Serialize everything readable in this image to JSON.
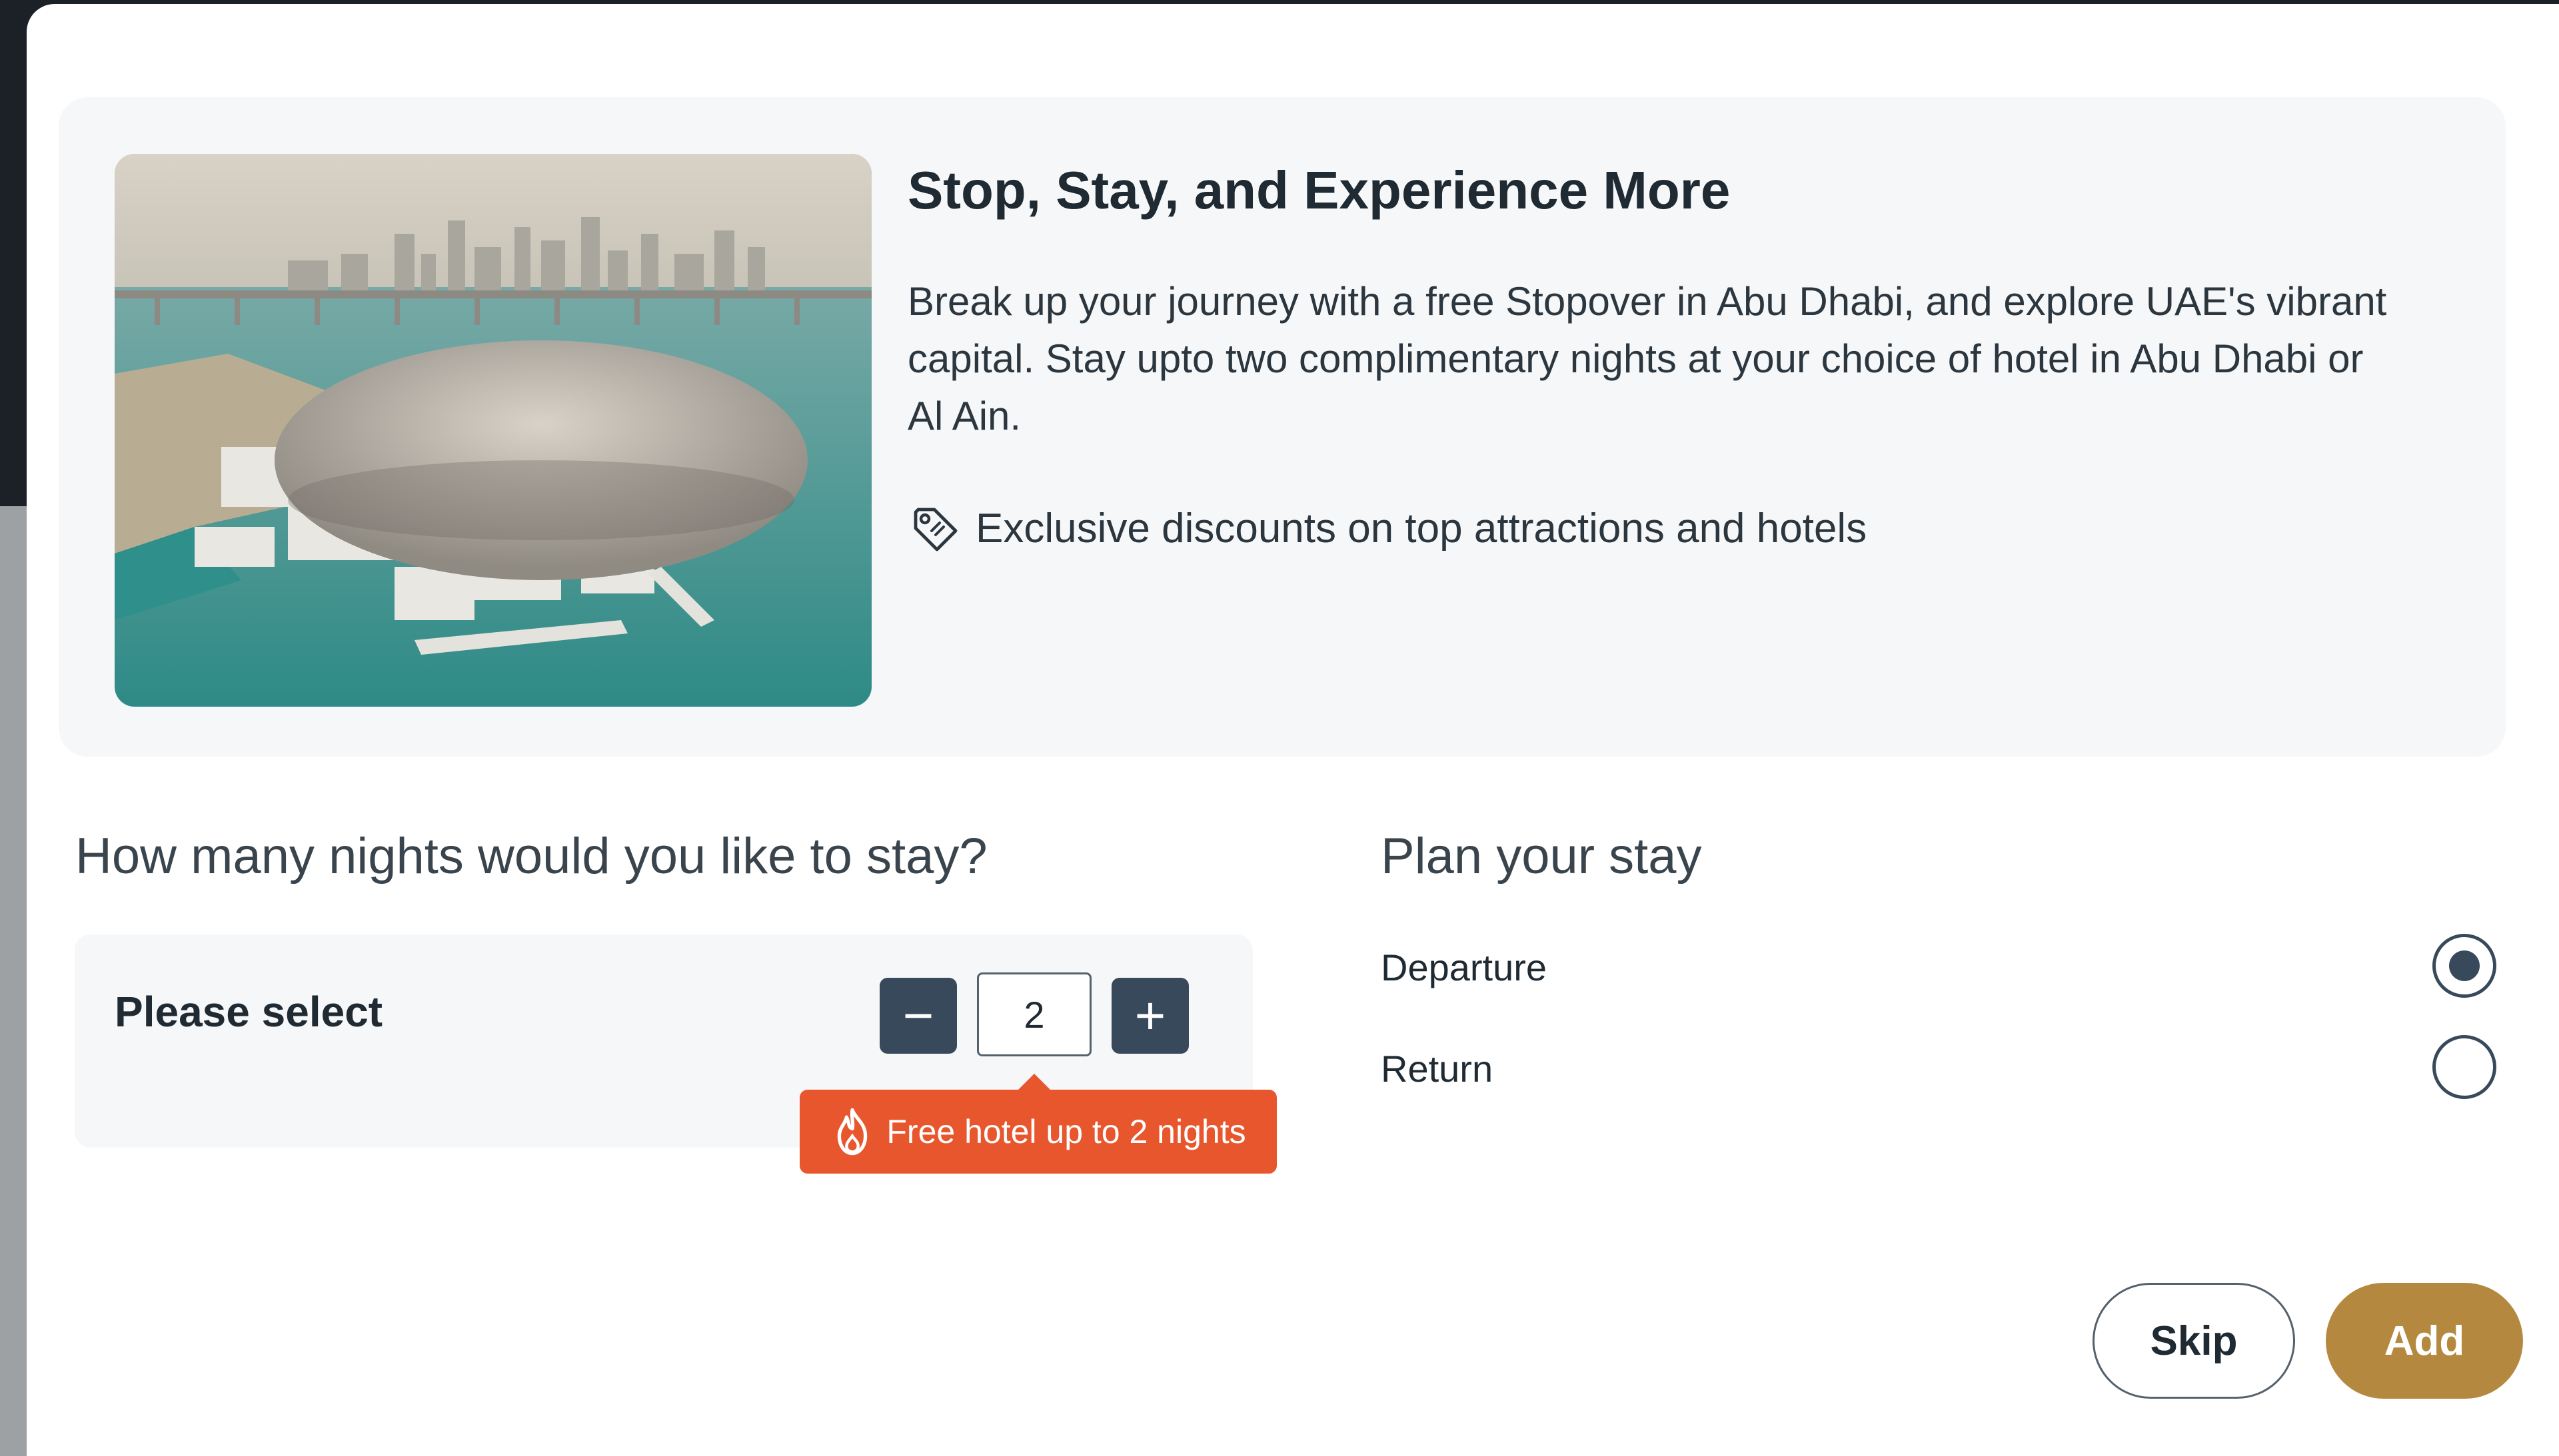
{
  "promo": {
    "title": "Stop, Stay, and Experience More",
    "description": "Break up your journey with a free Stopover in Abu Dhabi, and explore UAE's vibrant capital. Stay upto two complimentary nights at your choice of hotel in Abu Dhabi or Al Ain.",
    "perk_text": "Exclusive discounts on top attractions and hotels",
    "perk_icon": "tag-icon",
    "image_icon": "louvre-abu-dhabi-photo"
  },
  "nights": {
    "question": "How many nights would you like to stay?",
    "select_label": "Please select",
    "minus_symbol": "−",
    "plus_symbol": "+",
    "value": "2",
    "badge_text": "Free hotel up to 2 nights",
    "badge_icon": "flame-icon"
  },
  "plan": {
    "title": "Plan your stay",
    "options": [
      {
        "label": "Departure",
        "selected": true
      },
      {
        "label": "Return",
        "selected": false
      }
    ]
  },
  "actions": {
    "skip_label": "Skip",
    "add_label": "Add"
  },
  "colors": {
    "accent_gold": "#b4893f",
    "badge_orange": "#e8562e",
    "stepper_slate": "#37495a",
    "text_dark": "#1f2a33"
  }
}
